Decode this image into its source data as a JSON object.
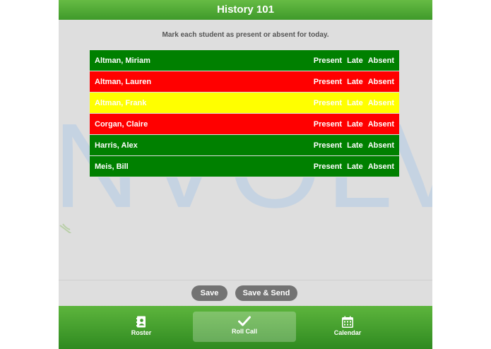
{
  "header": {
    "title": "History 101"
  },
  "instructions": "Mark each student as present or absent for today.",
  "watermark": {
    "text": "NVOLVE"
  },
  "status_options": {
    "present": "Present",
    "late": "Late",
    "absent": "Absent"
  },
  "students": [
    {
      "name": "Altman, Miriam",
      "status": "present"
    },
    {
      "name": "Altman, Lauren",
      "status": "absent"
    },
    {
      "name": "Altman, Frank",
      "status": "late"
    },
    {
      "name": "Corgan, Claire",
      "status": "absent"
    },
    {
      "name": "Harris, Alex",
      "status": "present"
    },
    {
      "name": "Meis, Bill",
      "status": "present"
    }
  ],
  "buttons": {
    "save": "Save",
    "save_send": "Save & Send"
  },
  "tabs": [
    {
      "label": "Roster",
      "icon": "contact-book-icon"
    },
    {
      "label": "Roll Call",
      "icon": "checkmark-icon",
      "active": true
    },
    {
      "label": "Calendar",
      "icon": "calendar-icon"
    }
  ],
  "colors": {
    "present": "#008000",
    "absent": "#ff0000",
    "late": "#ffff00",
    "header": "#4aa832"
  }
}
